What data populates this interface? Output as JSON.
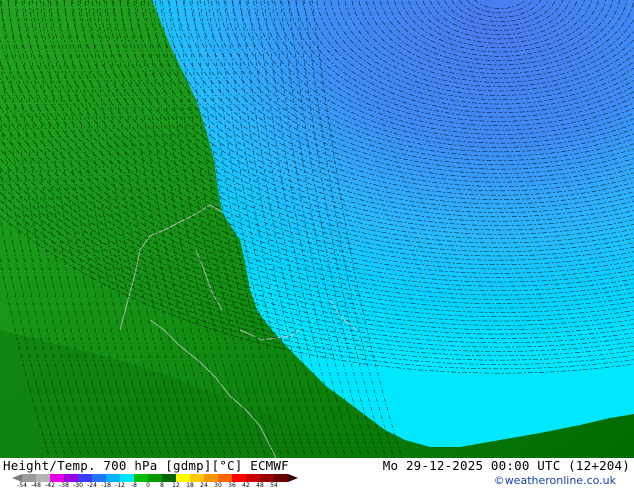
{
  "title_left": "Height/Temp. 700 hPa [gdmp][°C] ECMWF",
  "title_right": "Mo 29-12-2025 00:00 UTC (12+204)",
  "credit": "©weatheronline.co.uk",
  "colorbar": {
    "ticks": [
      "-54",
      "-48",
      "-42",
      "-38",
      "-30",
      "-24",
      "-18",
      "-12",
      "-8",
      "0",
      "8",
      "12",
      "18",
      "24",
      "30",
      "36",
      "42",
      "48",
      "54"
    ],
    "colors": [
      "#9a9a9a",
      "#b4b4b4",
      "#e600e6",
      "#9b00e0",
      "#3c3cff",
      "#1e78ff",
      "#00b4ff",
      "#00e6ff",
      "#00be00",
      "#009600",
      "#006400",
      "#ffff00",
      "#ffc800",
      "#ff9600",
      "#ff6400",
      "#ff0000",
      "#c80000",
      "#960000",
      "#640000"
    ],
    "left_arrow_color": "#7a7a7a",
    "right_arrow_color": "#3a0000"
  },
  "map_colors": {
    "green_dark": "#006a00",
    "green_mid": "#138f13",
    "green_light": "#22a522",
    "cyan": "#00e8ff",
    "sky": "#29b8ff",
    "blue": "#3f8cf5",
    "blue_deep": "#4a7bf0",
    "coastline": "#c8c8c8",
    "contour": "#000000"
  }
}
